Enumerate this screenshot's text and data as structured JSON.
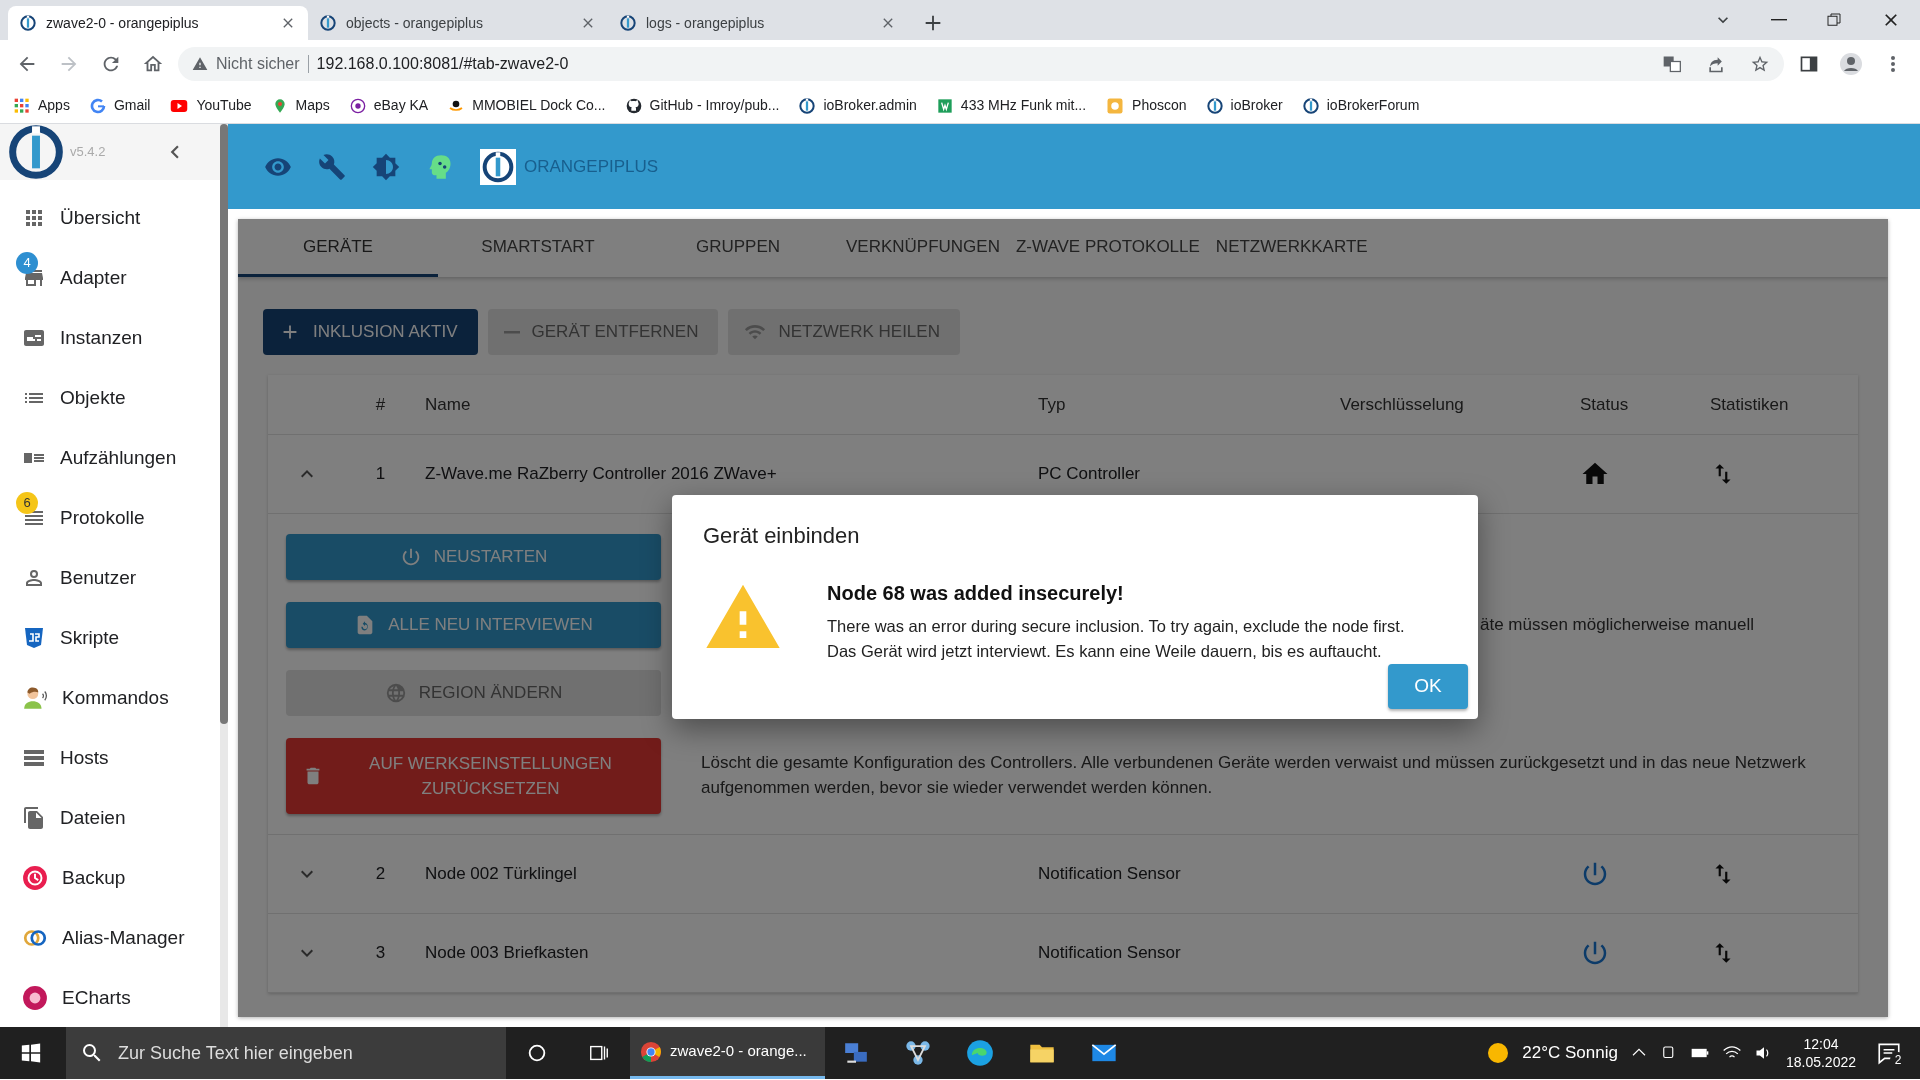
{
  "browser": {
    "tabs": [
      {
        "title": "zwave2-0 - orangepiplus",
        "selected": true
      },
      {
        "title": "objects - orangepiplus",
        "selected": false
      },
      {
        "title": "logs - orangepiplus",
        "selected": false
      }
    ],
    "security": "Nicht sicher",
    "url": "192.168.0.100:8081/#tab-zwave2-0",
    "bookmarks": [
      "Apps",
      "Gmail",
      "YouTube",
      "Maps",
      "eBay KA",
      "MMOBIEL Dock Co...",
      "GitHub - Imroy/pub...",
      "ioBroker.admin",
      "433 MHz Funk mit...",
      "Phoscon",
      "ioBroker",
      "ioBrokerForum"
    ]
  },
  "sidebar": {
    "version": "v5.4.2",
    "items": [
      {
        "label": "Übersicht"
      },
      {
        "label": "Adapter",
        "badge": {
          "text": "4",
          "color": "#2e8fd1"
        }
      },
      {
        "label": "Instanzen"
      },
      {
        "label": "Objekte"
      },
      {
        "label": "Aufzählungen"
      },
      {
        "label": "Protokolle",
        "badge": {
          "text": "6",
          "color": "#f5c518"
        }
      },
      {
        "label": "Benutzer"
      },
      {
        "label": "Skripte"
      },
      {
        "label": "Kommandos"
      },
      {
        "label": "Hosts"
      },
      {
        "label": "Dateien"
      },
      {
        "label": "Backup"
      },
      {
        "label": "Alias-Manager"
      },
      {
        "label": "ECharts"
      }
    ]
  },
  "header": {
    "title": "ORANGEPIPLUS"
  },
  "tabs": [
    {
      "label": "GERÄTE",
      "selected": true
    },
    {
      "label": "SMARTSTART",
      "selected": false
    },
    {
      "label": "GRUPPEN",
      "selected": false
    },
    {
      "label": "VERKNÜPFUNGEN",
      "selected": false
    },
    {
      "label": "Z-WAVE PROTOKOLLE",
      "selected": false
    },
    {
      "label": "NETZWERKKARTE",
      "selected": false
    }
  ],
  "toolbar": [
    {
      "label": "INKLUSION AKTIV",
      "disabled": false
    },
    {
      "label": "GERÄT ENTFERNEN",
      "disabled": true
    },
    {
      "label": "NETZWERK HEILEN",
      "disabled": true
    }
  ],
  "table": {
    "columns": [
      "#",
      "Name",
      "Typ",
      "Verschlüsselung",
      "Status",
      "Statistiken"
    ],
    "rows": [
      {
        "number": "1",
        "name": "Z-Wave.me RaZberry Controller 2016 ZWave+",
        "type": "PC Controller",
        "kind": "controller",
        "expanded": true,
        "actions": [
          {
            "label": "NEUSTARTEN",
            "kind": "primary"
          },
          {
            "label": "ALLE NEU INTERVIEWEN",
            "kind": "primary",
            "description": "äte müssen möglicherweise manuell"
          },
          {
            "label": "REGION ÄNDERN",
            "kind": "disabled"
          },
          {
            "label": "AUF WERKSEINSTELLUNGEN ZURÜCKSETZEN",
            "kind": "danger",
            "description": "Löscht die gesamte Konfiguration des Controllers. Alle verbundenen Geräte werden verwaist und müssen zurückgesetzt und in das neue Netzwerk aufgenommen werden, bevor sie wieder verwendet werden können."
          }
        ]
      },
      {
        "number": "2",
        "name": "Node 002 Türklingel",
        "type": "Notification Sensor",
        "kind": "sensor",
        "expanded": false
      },
      {
        "number": "3",
        "name": "Node 003 Briefkasten",
        "type": "Notification Sensor",
        "kind": "sensor",
        "expanded": false
      }
    ]
  },
  "dialog": {
    "title": "Gerät einbinden",
    "heading": "Node 68 was added insecurely!",
    "lines": [
      "There was an error during secure inclusion. To try again, exclude the node first.",
      "Das Gerät wird jetzt interviewt. Es kann eine Weile dauern, bis es auftaucht."
    ],
    "button": "OK"
  },
  "taskbar": {
    "search_placeholder": "Zur Suche Text hier eingeben",
    "app": "zwave2-0 - orange...",
    "weather": "22°C Sonnig",
    "time": "12:04",
    "date": "18.05.2022",
    "notifications": "2"
  }
}
